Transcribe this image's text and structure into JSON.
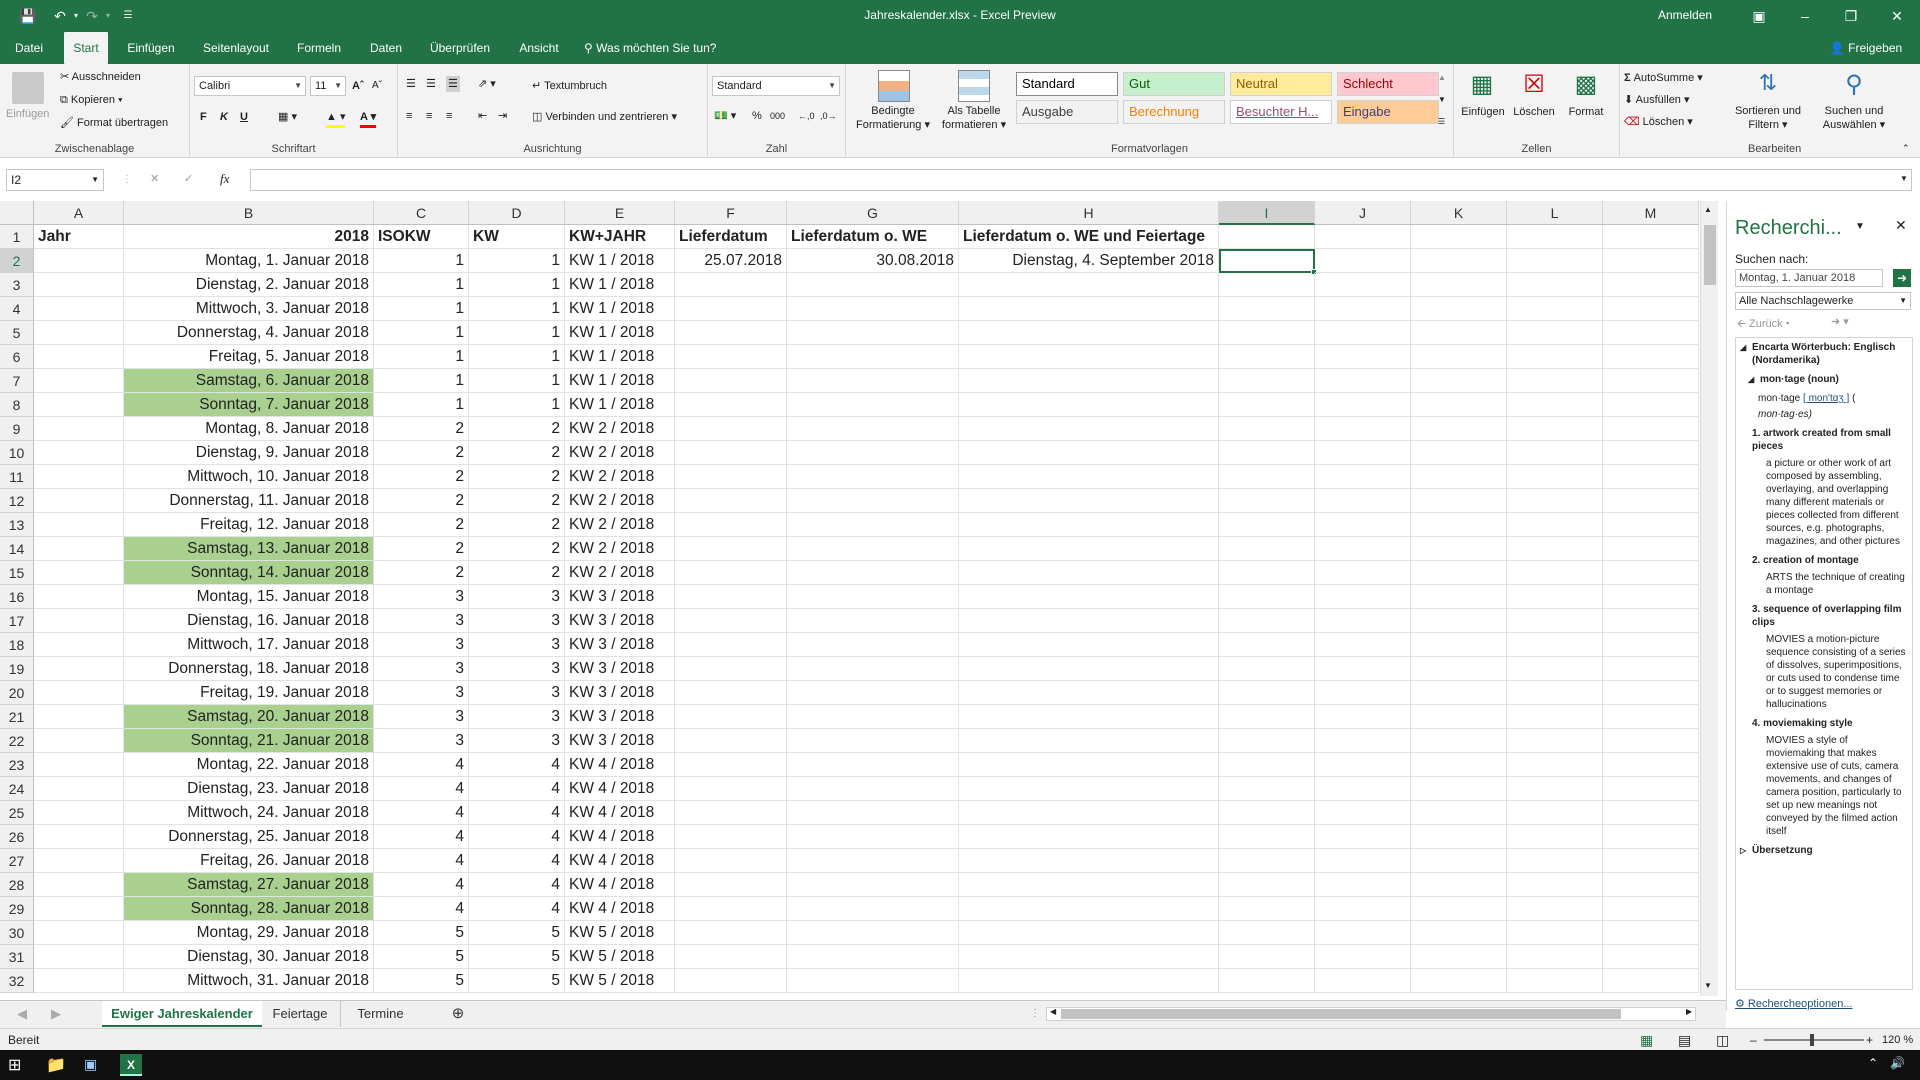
{
  "titlebar": {
    "title": "Jahreskalender.xlsx - Excel Preview",
    "signin": "Anmelden"
  },
  "ribbon_tabs": [
    "Datei",
    "Start",
    "Einfügen",
    "Seitenlayout",
    "Formeln",
    "Daten",
    "Überprüfen",
    "Ansicht"
  ],
  "tell_me": "Was möchten Sie tun?",
  "share": "Freigeben",
  "clipboard": {
    "paste": "Einfügen",
    "cut": "Ausschneiden",
    "copy": "Kopieren",
    "format_painter": "Format übertragen",
    "label": "Zwischenablage"
  },
  "font": {
    "name": "Calibri",
    "size": "11",
    "label": "Schriftart",
    "bold": "F",
    "italic": "K",
    "underline": "U"
  },
  "alignment": {
    "wrap": "Textumbruch",
    "merge": "Verbinden und zentrieren",
    "label": "Ausrichtung"
  },
  "number": {
    "format": "Standard",
    "percent": "%",
    "thousands": "000",
    "label": "Zahl"
  },
  "styles": {
    "conditional": [
      "Bedingte",
      "Formatierung"
    ],
    "as_table": [
      "Als Tabelle",
      "formatieren"
    ],
    "label": "Formatvorlagen",
    "cells": [
      {
        "label": "Standard",
        "bg": "#ffffff",
        "fg": "#000000"
      },
      {
        "label": "Gut",
        "bg": "#c6efce",
        "fg": "#006100"
      },
      {
        "label": "Neutral",
        "bg": "#ffeb9c",
        "fg": "#9c5700"
      },
      {
        "label": "Schlecht",
        "bg": "#ffc7ce",
        "fg": "#9c0006"
      },
      {
        "label": "Ausgabe",
        "bg": "#f2f2f2",
        "fg": "#3f3f3f"
      },
      {
        "label": "Berechnung",
        "bg": "#f2f2f2",
        "fg": "#fa7d00"
      },
      {
        "label": "Besuchter H...",
        "bg": "#ffffff",
        "fg": "#954f72"
      },
      {
        "label": "Eingabe",
        "bg": "#ffcc99",
        "fg": "#3f3f76"
      }
    ]
  },
  "cells_group": {
    "insert": "Einfügen",
    "delete": "Löschen",
    "format": "Format",
    "label": "Zellen"
  },
  "editing": {
    "autosum": "AutoSumme",
    "fill": "Ausfüllen",
    "clear": "Löschen",
    "sort": [
      "Sortieren und",
      "Filtern"
    ],
    "find": [
      "Suchen und",
      "Auswählen"
    ],
    "label": "Bearbeiten"
  },
  "formula_bar": {
    "name_box": "I2",
    "fx": "fx"
  },
  "columns": [
    "A",
    "B",
    "C",
    "D",
    "E",
    "F",
    "G",
    "H",
    "I",
    "J",
    "K",
    "L",
    "M"
  ],
  "header_row": {
    "A": "Jahr",
    "B": "2018",
    "C": "ISOKW",
    "D": "KW",
    "E": "KW+JAHR",
    "F": "Lieferdatum",
    "G": "Lieferdatum o. WE",
    "H": "Lieferdatum o. WE und Feiertage"
  },
  "row2_extra": {
    "F": "25.07.2018",
    "G": "30.08.2018",
    "H": "Dienstag, 4. September 2018"
  },
  "rows": [
    {
      "n": "2",
      "date": "Montag, 1. Januar 2018",
      "isokw": "1",
      "kw": "1",
      "kwj": "KW 1 / 2018",
      "we": false
    },
    {
      "n": "3",
      "date": "Dienstag, 2. Januar 2018",
      "isokw": "1",
      "kw": "1",
      "kwj": "KW 1 / 2018",
      "we": false
    },
    {
      "n": "4",
      "date": "Mittwoch, 3. Januar 2018",
      "isokw": "1",
      "kw": "1",
      "kwj": "KW 1 / 2018",
      "we": false
    },
    {
      "n": "5",
      "date": "Donnerstag, 4. Januar 2018",
      "isokw": "1",
      "kw": "1",
      "kwj": "KW 1 / 2018",
      "we": false
    },
    {
      "n": "6",
      "date": "Freitag, 5. Januar 2018",
      "isokw": "1",
      "kw": "1",
      "kwj": "KW 1 / 2018",
      "we": false
    },
    {
      "n": "7",
      "date": "Samstag, 6. Januar 2018",
      "isokw": "1",
      "kw": "1",
      "kwj": "KW 1 / 2018",
      "we": true
    },
    {
      "n": "8",
      "date": "Sonntag, 7. Januar 2018",
      "isokw": "1",
      "kw": "1",
      "kwj": "KW 1 / 2018",
      "we": true
    },
    {
      "n": "9",
      "date": "Montag, 8. Januar 2018",
      "isokw": "2",
      "kw": "2",
      "kwj": "KW 2 / 2018",
      "we": false
    },
    {
      "n": "10",
      "date": "Dienstag, 9. Januar 2018",
      "isokw": "2",
      "kw": "2",
      "kwj": "KW 2 / 2018",
      "we": false
    },
    {
      "n": "11",
      "date": "Mittwoch, 10. Januar 2018",
      "isokw": "2",
      "kw": "2",
      "kwj": "KW 2 / 2018",
      "we": false
    },
    {
      "n": "12",
      "date": "Donnerstag, 11. Januar 2018",
      "isokw": "2",
      "kw": "2",
      "kwj": "KW 2 / 2018",
      "we": false
    },
    {
      "n": "13",
      "date": "Freitag, 12. Januar 2018",
      "isokw": "2",
      "kw": "2",
      "kwj": "KW 2 / 2018",
      "we": false
    },
    {
      "n": "14",
      "date": "Samstag, 13. Januar 2018",
      "isokw": "2",
      "kw": "2",
      "kwj": "KW 2 / 2018",
      "we": true
    },
    {
      "n": "15",
      "date": "Sonntag, 14. Januar 2018",
      "isokw": "2",
      "kw": "2",
      "kwj": "KW 2 / 2018",
      "we": true
    },
    {
      "n": "16",
      "date": "Montag, 15. Januar 2018",
      "isokw": "3",
      "kw": "3",
      "kwj": "KW 3 / 2018",
      "we": false
    },
    {
      "n": "17",
      "date": "Dienstag, 16. Januar 2018",
      "isokw": "3",
      "kw": "3",
      "kwj": "KW 3 / 2018",
      "we": false
    },
    {
      "n": "18",
      "date": "Mittwoch, 17. Januar 2018",
      "isokw": "3",
      "kw": "3",
      "kwj": "KW 3 / 2018",
      "we": false
    },
    {
      "n": "19",
      "date": "Donnerstag, 18. Januar 2018",
      "isokw": "3",
      "kw": "3",
      "kwj": "KW 3 / 2018",
      "we": false
    },
    {
      "n": "20",
      "date": "Freitag, 19. Januar 2018",
      "isokw": "3",
      "kw": "3",
      "kwj": "KW 3 / 2018",
      "we": false
    },
    {
      "n": "21",
      "date": "Samstag, 20. Januar 2018",
      "isokw": "3",
      "kw": "3",
      "kwj": "KW 3 / 2018",
      "we": true
    },
    {
      "n": "22",
      "date": "Sonntag, 21. Januar 2018",
      "isokw": "3",
      "kw": "3",
      "kwj": "KW 3 / 2018",
      "we": true
    },
    {
      "n": "23",
      "date": "Montag, 22. Januar 2018",
      "isokw": "4",
      "kw": "4",
      "kwj": "KW 4 / 2018",
      "we": false
    },
    {
      "n": "24",
      "date": "Dienstag, 23. Januar 2018",
      "isokw": "4",
      "kw": "4",
      "kwj": "KW 4 / 2018",
      "we": false
    },
    {
      "n": "25",
      "date": "Mittwoch, 24. Januar 2018",
      "isokw": "4",
      "kw": "4",
      "kwj": "KW 4 / 2018",
      "we": false
    },
    {
      "n": "26",
      "date": "Donnerstag, 25. Januar 2018",
      "isokw": "4",
      "kw": "4",
      "kwj": "KW 4 / 2018",
      "we": false
    },
    {
      "n": "27",
      "date": "Freitag, 26. Januar 2018",
      "isokw": "4",
      "kw": "4",
      "kwj": "KW 4 / 2018",
      "we": false
    },
    {
      "n": "28",
      "date": "Samstag, 27. Januar 2018",
      "isokw": "4",
      "kw": "4",
      "kwj": "KW 4 / 2018",
      "we": true
    },
    {
      "n": "29",
      "date": "Sonntag, 28. Januar 2018",
      "isokw": "4",
      "kw": "4",
      "kwj": "KW 4 / 2018",
      "we": true
    },
    {
      "n": "30",
      "date": "Montag, 29. Januar 2018",
      "isokw": "5",
      "kw": "5",
      "kwj": "KW 5 / 2018",
      "we": false
    },
    {
      "n": "31",
      "date": "Dienstag, 30. Januar 2018",
      "isokw": "5",
      "kw": "5",
      "kwj": "KW 5 / 2018",
      "we": false
    },
    {
      "n": "32",
      "date": "Mittwoch, 31. Januar 2018",
      "isokw": "5",
      "kw": "5",
      "kwj": "KW 5 / 2018",
      "we": false
    }
  ],
  "research": {
    "title": "Recherchi...",
    "search_for_label": "Suchen nach:",
    "search_value": "Montag, 1. Januar 2018",
    "source": "Alle Nachschlagewerke",
    "back": "Zurück",
    "dict_title": "Encarta Wörterbuch: Englisch (Nordamerika)",
    "headword": "mon·tage (noun)",
    "pron_word": "mon·tage",
    "pron": "[ mon'tɑʒ ]",
    "pron_close": "(",
    "plural": "mon·tag·es)",
    "senses": [
      {
        "head": "1. artwork created from small pieces",
        "body": "a picture or other work of art composed by assembling, overlaying, and overlapping many different materials or pieces collected from different sources, e.g. photographs, magazines, and other pictures"
      },
      {
        "head": "2. creation of montage",
        "body": "ARTS the technique of creating a montage"
      },
      {
        "head": "3. sequence of overlapping film clips",
        "body": "MOVIES a motion-picture sequence consisting of a series of dissolves, superimpositions, or cuts used to condense time or to suggest memories or hallucinations"
      },
      {
        "head": "4. moviemaking style",
        "body": "MOVIES a style of moviemaking that makes extensive use of cuts, camera movements, and changes of camera position, particularly to set up new meanings not conveyed by the filmed action itself"
      }
    ],
    "translation": "Übersetzung",
    "options": "Rechercheoptionen..."
  },
  "sheets": [
    "Ewiger Jahreskalender",
    "Feiertage",
    "Termine"
  ],
  "status": {
    "ready": "Bereit",
    "zoom": "120 %"
  },
  "accent": "#217346",
  "weekend_fill": "#a9d08e"
}
